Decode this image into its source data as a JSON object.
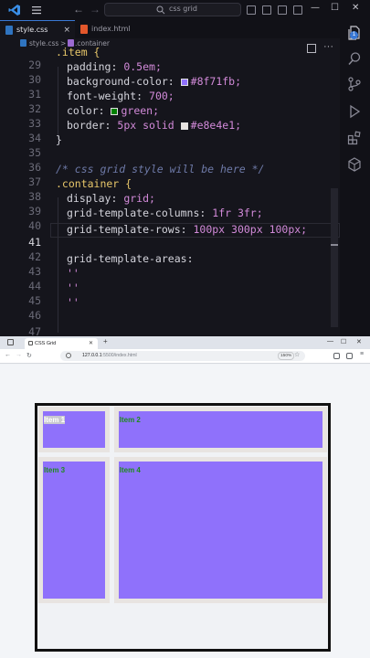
{
  "vscode": {
    "search_text": "css grid",
    "tabs": [
      {
        "label": "style.css",
        "icon": "css-file-icon",
        "active": true
      },
      {
        "label": "index.html",
        "icon": "html-file-icon",
        "active": false
      }
    ],
    "breadcrumb": {
      "file": "style.css",
      "separator": ">",
      "symbol": ".container"
    },
    "badge_count": "1",
    "colors": {
      "accent": "#3a78d4",
      "selector": "#e8c76a",
      "value": "#d28ad9",
      "comment": "#6e7aa8"
    },
    "lines": [
      {
        "n": "29",
        "text": ".item {"
      },
      {
        "n": "30",
        "prop": "padding",
        "val": "0.5em;"
      },
      {
        "n": "31",
        "prop": "background-color",
        "swatch": "#8f71fb",
        "val": "#8f71fb;"
      },
      {
        "n": "32",
        "prop": "font-weight",
        "val": "700;"
      },
      {
        "n": "33",
        "prop": "color",
        "swatch": "green",
        "val": "green;"
      },
      {
        "n": "34",
        "prop": "border",
        "val": "5px solid",
        "swatch": "#e8e4e1",
        "val2": "#e8e4e1;"
      },
      {
        "n": "35",
        "text": "}"
      },
      {
        "n": "36",
        "text": ""
      },
      {
        "n": "37",
        "comment": "/* css grid style will be here */"
      },
      {
        "n": "38",
        "text": ".container {"
      },
      {
        "n": "39",
        "prop": "display",
        "val": "grid;"
      },
      {
        "n": "40",
        "prop": "grid-template-columns",
        "val": "1fr 3fr;"
      },
      {
        "n": "41",
        "prop": "grid-template-rows",
        "val": "100px 300px 100px;"
      },
      {
        "n": "42",
        "text": ""
      },
      {
        "n": "43",
        "prop": "grid-template-areas",
        "val": ""
      },
      {
        "n": "44",
        "str": "''"
      },
      {
        "n": "45",
        "str": "''"
      },
      {
        "n": "46",
        "str": "''"
      },
      {
        "n": "47",
        "text": ""
      }
    ]
  },
  "browser": {
    "tab_title": "CSS Grid",
    "url_host": "127.0.0.1",
    "url_rest": ":5500/index.html",
    "zoom": "150%",
    "grid_items": [
      {
        "label": "Item 1"
      },
      {
        "label": "Item 2"
      },
      {
        "label": "Item 3"
      },
      {
        "label": "Item 4"
      }
    ]
  }
}
